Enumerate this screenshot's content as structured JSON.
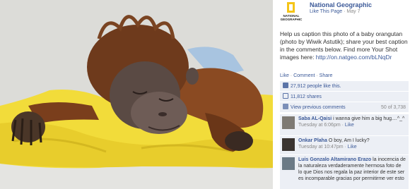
{
  "header": {
    "logo_text_line1": "NATIONAL",
    "logo_text_line2": "GEOGRAPHIC",
    "page_name": "National Geographic",
    "like_page": "Like This Page",
    "date": "May 7"
  },
  "post": {
    "caption": "Help us caption this photo of a baby orangutan (photo by Wiwik Astutik); share your best caption in the comments below. Find more Your Shot images here: ",
    "caption_link": "http://on.natgeo.com/bLNqDr",
    "actions": {
      "like": "Like",
      "comment": "Comment",
      "share": "Share"
    }
  },
  "ufi": {
    "likes": "27,912 people like this.",
    "shares": "11,812 shares",
    "view_previous": "View previous comments",
    "count": "50 of 3,738"
  },
  "comments": [
    {
      "name": "Saba AL-Qaisi",
      "text": "i wanna give him a big hug....^_^",
      "time": "Tuesday at 6:06pm",
      "like": "Like"
    },
    {
      "name": "Onkar Plaha",
      "text": "O boy, Am I lucky?",
      "time": "Tuesday at 10:47pm",
      "like": "Like"
    },
    {
      "name": "Luis Gonzalo Altamirano Erazo",
      "text": "la inocencia de la naturaleza verdaderamente hermosa foto de lo que Dios nos regala la paz interior de este ser es incomparable gracias por permitirme ver esto",
      "time": "",
      "like": ""
    }
  ],
  "icons": {
    "like": "thumbs-up-icon",
    "share": "share-icon",
    "comments": "comment-bubble-icon"
  },
  "colors": {
    "link": "#3b5998",
    "ufi_bg": "#eceff5",
    "logo_yellow": "#f5c518"
  }
}
